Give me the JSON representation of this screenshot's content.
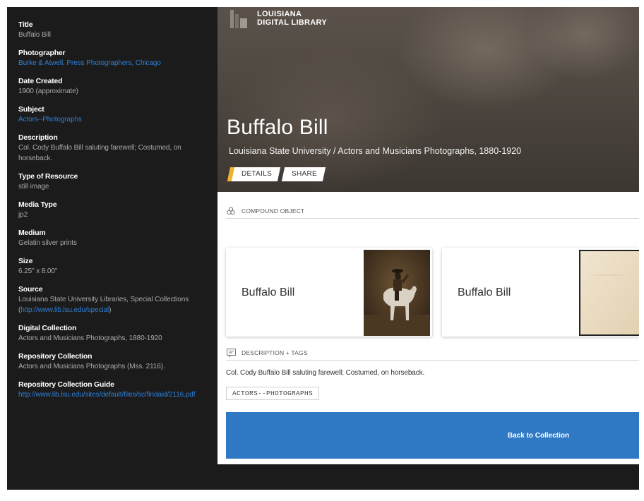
{
  "sidebar": {
    "fields": [
      {
        "label": "Title",
        "value": "Buffalo Bill"
      },
      {
        "label": "Photographer",
        "value": "Burke & Atwell, Press Photographers, Chicago"
      },
      {
        "label": "Date Created",
        "value": "1900 (approximate)"
      },
      {
        "label": "Subject",
        "value": "Actors--Photographs"
      },
      {
        "label": "Description",
        "value": "Col. Cody Buffalo Bill saluting farewell; Costumed, on horseback."
      },
      {
        "label": "Type of Resource",
        "value": "still image"
      },
      {
        "label": "Media Type",
        "value": "jp2"
      },
      {
        "label": "Medium",
        "value": "Gelatin silver prints"
      },
      {
        "label": "Size",
        "value": "6.25\" x 8.00\""
      },
      {
        "label": "Source",
        "value_prefix": "Louisiana State University Libraries, Special Collections (",
        "link": "http://www.lib.lsu.edu/special",
        "value_suffix": ")"
      },
      {
        "label": "Digital Collection",
        "value": "Actors and Musicians Photographs, 1880-1920"
      },
      {
        "label": "Repository Collection",
        "value": "Actors and Musicians Photographs (Mss. 2116)."
      },
      {
        "label": "Repository Collection Guide",
        "value": "http://www.lib.lsu.edu/sites/default/files/sc/findaid/2116.pdf"
      }
    ]
  },
  "header": {
    "logo_line1": "LOUISIANA",
    "logo_line2": "DIGITAL LIBRARY",
    "title": "Buffalo Bill",
    "subtitle": "Louisiana State University / Actors and Musicians Photographs, 1880-1920",
    "tabs": [
      {
        "label": "DETAILS"
      },
      {
        "label": "SHARE"
      }
    ]
  },
  "compound": {
    "heading": "COMPOUND OBJECT",
    "icon": "compound-object-icon",
    "items": [
      {
        "label": "Buffalo Bill"
      },
      {
        "label": "Buffalo Bill"
      }
    ]
  },
  "description": {
    "heading": "DESCRIPTION + TAGS",
    "icon": "description-icon",
    "text": "Col. Cody Buffalo Bill saluting farewell; Costumed, on horseback.",
    "tag": "ACTORS--PHOTOGRAPHS"
  },
  "back_button": "Back to Collection",
  "colors": {
    "accent": "#f0b330",
    "link": "#2f7fd6",
    "button": "#2f79c4",
    "sidebar_bg": "#1b1b1b"
  }
}
